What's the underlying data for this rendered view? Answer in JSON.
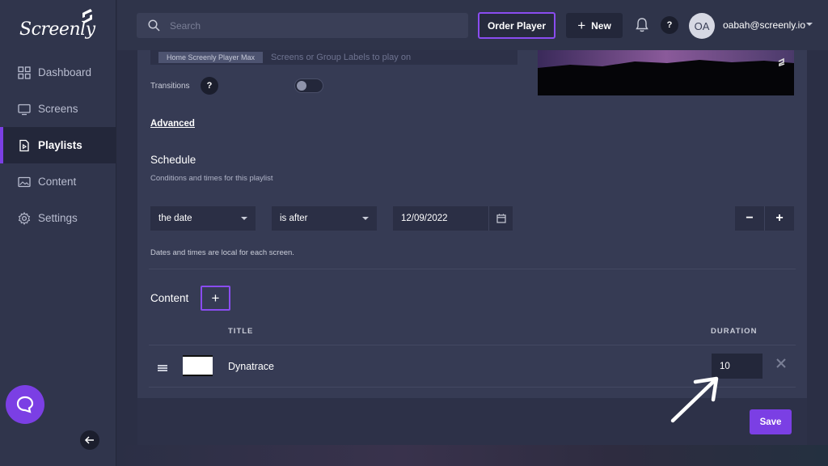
{
  "app": {
    "logo_text": "Screenly"
  },
  "colors": {
    "accent": "#7b3fe4",
    "sidebar_bg": "#30354c",
    "panel_bg": "#363b54"
  },
  "sidebar": {
    "items": [
      {
        "label": "Dashboard",
        "icon": "grid-icon",
        "active": false
      },
      {
        "label": "Screens",
        "icon": "monitor-icon",
        "active": false
      },
      {
        "label": "Playlists",
        "icon": "playlist-icon",
        "active": true
      },
      {
        "label": "Content",
        "icon": "image-icon",
        "active": false
      },
      {
        "label": "Settings",
        "icon": "gear-icon",
        "active": false
      }
    ]
  },
  "topbar": {
    "search_placeholder": "Search",
    "order_label": "Order Player",
    "new_label": "New",
    "help_label": "?",
    "avatar_initials": "OA",
    "user_email": "oabah@screenly.io"
  },
  "playlist": {
    "labels_tag": "Home Screenly Player Max",
    "labels_placeholder": "Screens or Group Labels to play on",
    "transitions_label": "Transitions",
    "help_label": "?",
    "advanced_label": "Advanced",
    "schedule": {
      "title": "Schedule",
      "subtitle": "Conditions and times for this playlist",
      "condition_field": "the date",
      "operator": "is after",
      "date_value": "12/09/2022",
      "minus": "−",
      "plus": "+",
      "timezone_note": "Dates and times are local for each screen."
    },
    "content": {
      "title": "Content",
      "add_label": "+",
      "col_title": "TITLE",
      "col_duration": "DURATION",
      "rows": [
        {
          "title": "Dynatrace",
          "duration": "10"
        }
      ]
    }
  },
  "footer": {
    "save_label": "Save"
  }
}
